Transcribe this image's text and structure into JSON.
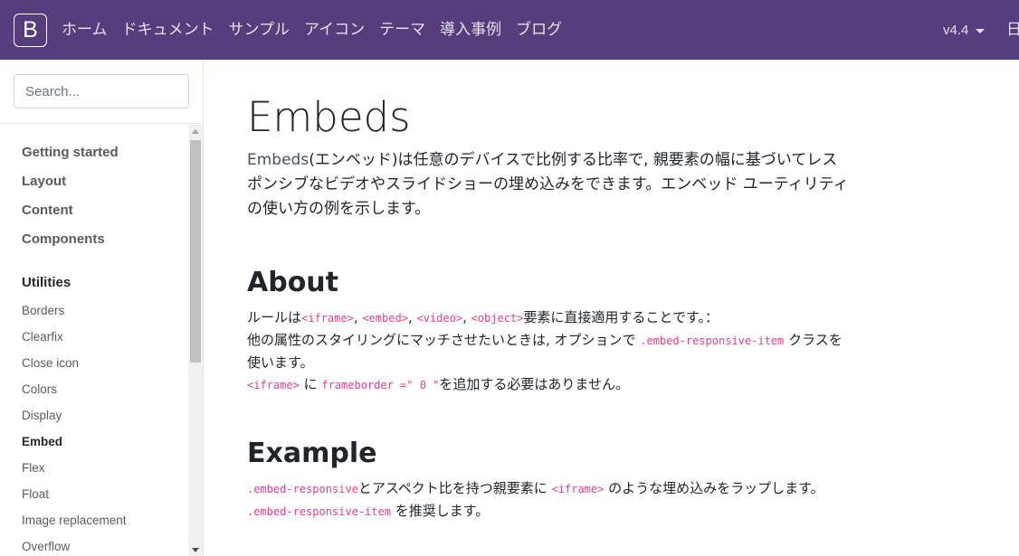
{
  "navbar": {
    "brand": "B",
    "links": [
      "ホーム",
      "ドキュメント",
      "サンプル",
      "アイコン",
      "テーマ",
      "導入事例",
      "ブログ"
    ],
    "version": "v4.4",
    "right_clip": "日"
  },
  "sidebar": {
    "search_placeholder": "Search...",
    "groups": [
      "Getting started",
      "Layout",
      "Content",
      "Components"
    ],
    "active_group": "Utilities",
    "items": [
      "Borders",
      "Clearfix",
      "Close icon",
      "Colors",
      "Display",
      "Embed",
      "Flex",
      "Float",
      "Image replacement",
      "Overflow"
    ],
    "active_item": "Embed"
  },
  "main": {
    "title": "Embeds",
    "lead_prefix": "Embeds",
    "lead_text": "(エンベッド)は任意のデバイスで比例する比率で, 親要素の幅に基づいてレスポンシブなビデオやスライドショーの埋め込みをできます。エンベッド ユーティリティの使い方の例を示します。",
    "about_heading": "About",
    "about_line1_a": "ルールは",
    "code_iframe": "<iframe>",
    "code_embed": "<embed>",
    "code_video": "<video>",
    "code_object": "<object>",
    "about_line1_b": "要素に直接適用することです。：",
    "about_line2_a": "他の属性のスタイリングにマッチさせたいときは, オプションで ",
    "code_item": ".embed-responsive-item",
    "about_line2_b": " クラスを使います。",
    "about_line3_a": " に ",
    "code_frameborder": "frameborder =\" 0 \"",
    "about_line3_b": "を追加する必要はありません。",
    "example_heading": "Example",
    "code_responsive": ".embed-responsive",
    "example_line1_a": "とアスペクト比を持つ親要素に ",
    "example_line1_b": " のような埋め込みをラップします。",
    "example_line2_b": " を推奨します。"
  }
}
